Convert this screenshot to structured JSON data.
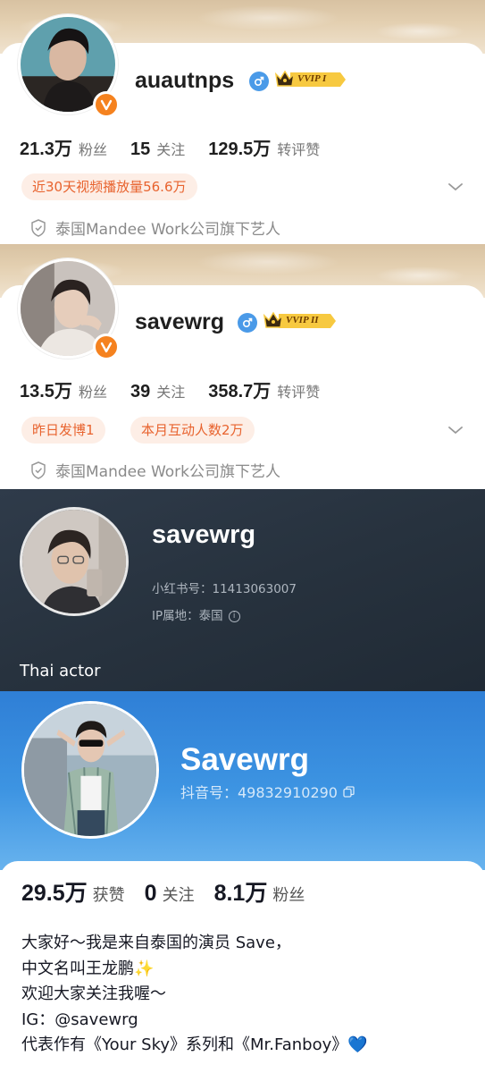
{
  "weibo_profiles": [
    {
      "username": "auautnps",
      "vip_label": "VVIP I",
      "stats": [
        {
          "value": "21.3万",
          "label": "粉丝"
        },
        {
          "value": "15",
          "label": "关注"
        },
        {
          "value": "129.5万",
          "label": "转评赞"
        }
      ],
      "tags": [
        "近30天视频播放量56.6万"
      ],
      "company": "泰国Mandee Work公司旗下艺人"
    },
    {
      "username": "savewrg",
      "vip_label": "VVIP II",
      "stats": [
        {
          "value": "13.5万",
          "label": "粉丝"
        },
        {
          "value": "39",
          "label": "关注"
        },
        {
          "value": "358.7万",
          "label": "转评赞"
        }
      ],
      "tags": [
        "昨日发博1",
        "本月互动人数2万"
      ],
      "company": "泰国Mandee Work公司旗下艺人"
    }
  ],
  "xiaohongshu": {
    "username": "savewrg",
    "id_line": "小红书号：11413063007",
    "ip_line": "IP属地：泰国",
    "bio": "Thai actor"
  },
  "douyin": {
    "username": "Savewrg",
    "id_line": "抖音号：49832910290",
    "stats": [
      {
        "value": "29.5万",
        "label": "获赞"
      },
      {
        "value": "0",
        "label": "关注"
      },
      {
        "value": "8.1万",
        "label": "粉丝"
      }
    ],
    "bio_lines": [
      "大家好～我是来自泰国的演员 Save，",
      "中文名叫王龙鹏",
      "欢迎大家关注我喔～",
      "IG：@savewrg",
      "代表作有《Your Sky》系列和《Mr.Fanboy》"
    ]
  },
  "colors": {
    "weibo_accent": "#f5821f",
    "tag_text": "#e8632e",
    "tag_bg": "#fdeee6",
    "xhs_bg": "#27323e",
    "douyin_blue": "#3d94e2"
  },
  "icons": [
    "verified-icon",
    "male-gender-icon",
    "vip-crown-icon",
    "chevron-down-icon",
    "shield-icon",
    "info-icon",
    "copy-icon",
    "sparkles-emoji",
    "blue-heart-emoji"
  ]
}
